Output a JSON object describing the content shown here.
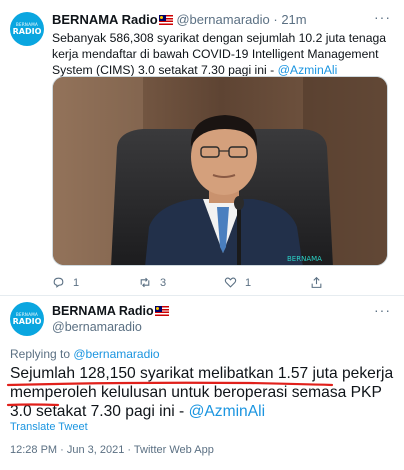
{
  "tweet1": {
    "avatar": {
      "top_text": "BERNAMA",
      "bottom_text": "RADIO"
    },
    "name": "BERNAMA Radio",
    "handle": "@bernamaradio",
    "separator": "·",
    "time": "21m",
    "more_icon": "more-dots-icon",
    "text": "Sebanyak 586,308 syarikat dengan sejumlah 10.2 juta tenaga kerja mendaftar di bawah COVID-19 Intelligent Management System (CIMS) 3.0 setakat 7.30 pagi ini - ",
    "mention": "@AzminAli",
    "photo_watermark": "BERNAMA",
    "actions": {
      "reply_count": "1",
      "retweet_count": "3",
      "like_count": "1"
    }
  },
  "tweet2": {
    "avatar": {
      "top_text": "BERNAMA",
      "bottom_text": "RADIO"
    },
    "name": "BERNAMA Radio",
    "handle": "@bernamaradio",
    "more_icon": "more-dots-icon",
    "replying_to_label": "Replying to ",
    "replying_to_handle": "@bernamaradio",
    "text": "Sejumlah 128,150 syarikat melibatkan 1.57 juta pekerja memperoleh kelulusan untuk beroperasi semasa PKP 3.0 setakat 7.30 pagi ini - ",
    "mention": "@AzminAli",
    "translate_label": "Translate Tweet",
    "meta": "12:28 PM · Jun 3, 2021 · Twitter Web App"
  },
  "colors": {
    "link": "#1b95e0",
    "secondary_text": "#5b7083",
    "avatar_bg": "#0aa6e0",
    "annotation_red": "#e0201b"
  }
}
